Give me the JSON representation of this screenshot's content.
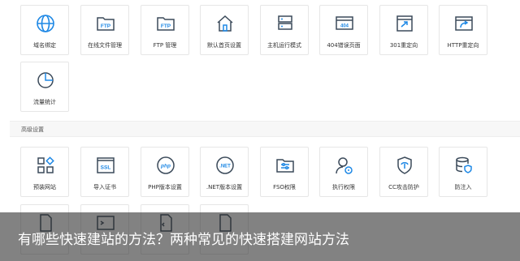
{
  "top_tiles": [
    {
      "label": "域名绑定",
      "icon": "globe-icon"
    },
    {
      "label": "在线文件管理",
      "icon": "ftp-folder-icon"
    },
    {
      "label": "FTP 管理",
      "icon": "ftp-folder-icon"
    },
    {
      "label": "默认首页设置",
      "icon": "home-icon"
    },
    {
      "label": "主机运行模式",
      "icon": "server-icon"
    },
    {
      "label": "404错误页面",
      "icon": "error-404-icon"
    },
    {
      "label": "301重定向",
      "icon": "redirect-icon"
    },
    {
      "label": "HTTP重定向",
      "icon": "http-redirect-icon"
    },
    {
      "label": "流量统计",
      "icon": "pie-chart-icon"
    }
  ],
  "advanced_section": {
    "title": "高级设置",
    "tiles": [
      {
        "label": "预装网站",
        "icon": "app-grid-icon"
      },
      {
        "label": "导入证书",
        "icon": "ssl-icon",
        "badge": "SSL"
      },
      {
        "label": "PHP版本设置",
        "icon": "php-icon",
        "badge": "php"
      },
      {
        "label": ".NET版本设置",
        "icon": "dotnet-icon",
        "badge": ".NET"
      },
      {
        "label": "FSO权限",
        "icon": "settings-folder-icon"
      },
      {
        "label": "执行权限",
        "icon": "user-lock-icon"
      },
      {
        "label": "CC攻击防护",
        "icon": "shield-icon"
      },
      {
        "label": "防注入",
        "icon": "database-shield-icon"
      }
    ]
  },
  "caption": "有哪些快速建站的方法？两种常见的快速搭建网站方法",
  "colors": {
    "icon": "#3b4a5a",
    "accent": "#1e88e5",
    "border": "#e6e6e6"
  }
}
